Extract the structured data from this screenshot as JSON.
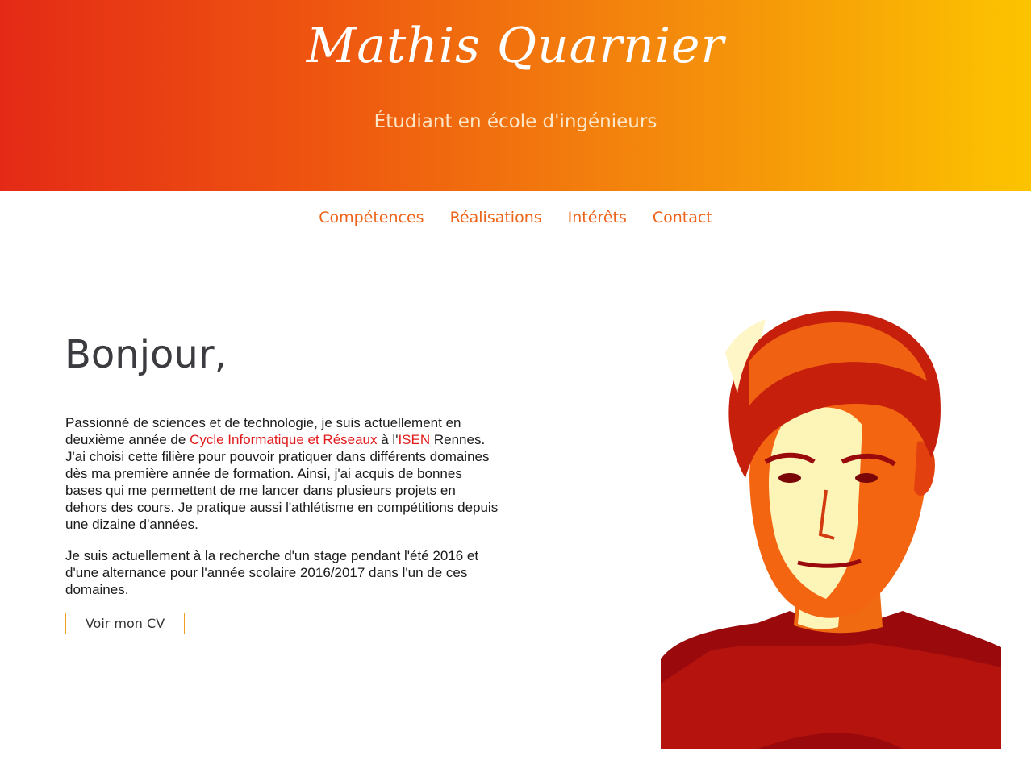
{
  "header": {
    "title": "Mathis Quarnier",
    "subtitle": "Étudiant en école d'ingénieurs"
  },
  "nav": {
    "items": [
      "Compétences",
      "Réalisations",
      "Intérêts",
      "Contact"
    ]
  },
  "main": {
    "greeting": "Bonjour,",
    "bio": {
      "p1_part1": "Passionné de sciences et de technologie, je suis actuellement en deuxième année de ",
      "link_cycle": "Cycle Informatique et Réseaux",
      "p1_part2": " à l'",
      "link_isen": "ISEN",
      "p1_part3": " Rennes. J'ai choisi cette filière pour pouvoir pratiquer dans différents domaines dès ma première année de formation. Ainsi, j'ai acquis de bonnes bases qui me permettent de me lancer dans plusieurs projets en dehors des cours. Je pratique aussi l'athlétisme en compétitions depuis une dizaine d'années.",
      "p2": "Je suis actuellement à la recherche d'un stage pendant l'été 2016 et d'une alternance pour l'année scolaire 2016/2017 dans l'un de ces domaines."
    },
    "cv_button": "Voir mon CV"
  },
  "colors": {
    "gradient_start": "#e42a16",
    "gradient_end": "#fcc400",
    "nav_link": "#ec6319",
    "bio_link": "#e11b1b",
    "button_border": "#f0a020"
  },
  "icons": {
    "portrait": "portrait-photo"
  }
}
